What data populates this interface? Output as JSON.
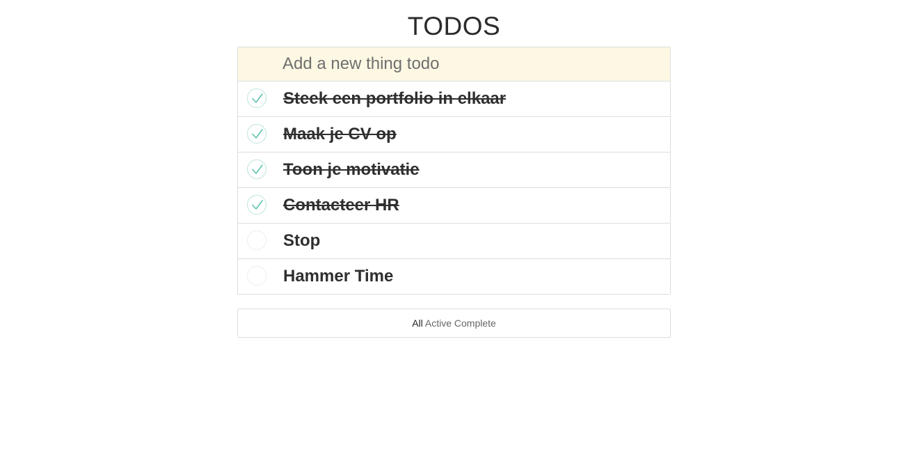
{
  "header": {
    "title": "TODOS"
  },
  "new_todo": {
    "placeholder": "Add a new thing todo",
    "value": ""
  },
  "todos": [
    {
      "text": "Steek een portfolio in elkaar",
      "completed": true
    },
    {
      "text": "Maak je CV op",
      "completed": true
    },
    {
      "text": "Toon je motivatie",
      "completed": true
    },
    {
      "text": "Contacteer HR",
      "completed": true
    },
    {
      "text": "Stop",
      "completed": false
    },
    {
      "text": "Hammer Time",
      "completed": false
    }
  ],
  "filters": {
    "all": "All",
    "active": "Active",
    "complete": "Complete",
    "selected": "all"
  },
  "icons": {
    "check": "check-icon"
  },
  "colors": {
    "input_bg": "#fcf8e3",
    "check": "#5dc2af",
    "border": "#dddddd"
  }
}
